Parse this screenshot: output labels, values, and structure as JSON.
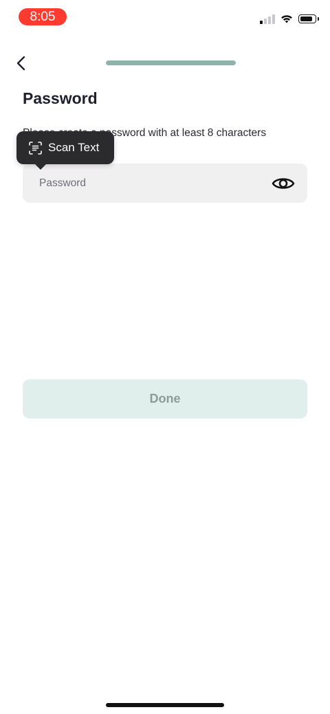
{
  "status_bar": {
    "time": "8:05",
    "signal_icon": "cellular-signal-icon",
    "wifi_icon": "wifi-icon",
    "battery_icon": "battery-icon"
  },
  "nav": {
    "back_icon": "chevron-left-icon",
    "progress": 1.0
  },
  "page": {
    "title": "Password",
    "instruction": "Please create a password with at least 8 characters"
  },
  "scan_popup": {
    "label": "Scan Text",
    "icon": "scan-text-icon"
  },
  "password_field": {
    "value": "",
    "placeholder": "Password",
    "toggle_icon": "eye-icon"
  },
  "done_button": {
    "label": "Done"
  },
  "colors": {
    "time_pill": "#ff3b30",
    "progress_fill": "#8fb3ab",
    "done_bg": "#e0efec",
    "done_text": "#8f9b98",
    "field_bg": "#f1f0f1",
    "popup_bg": "#2b2b2d"
  }
}
